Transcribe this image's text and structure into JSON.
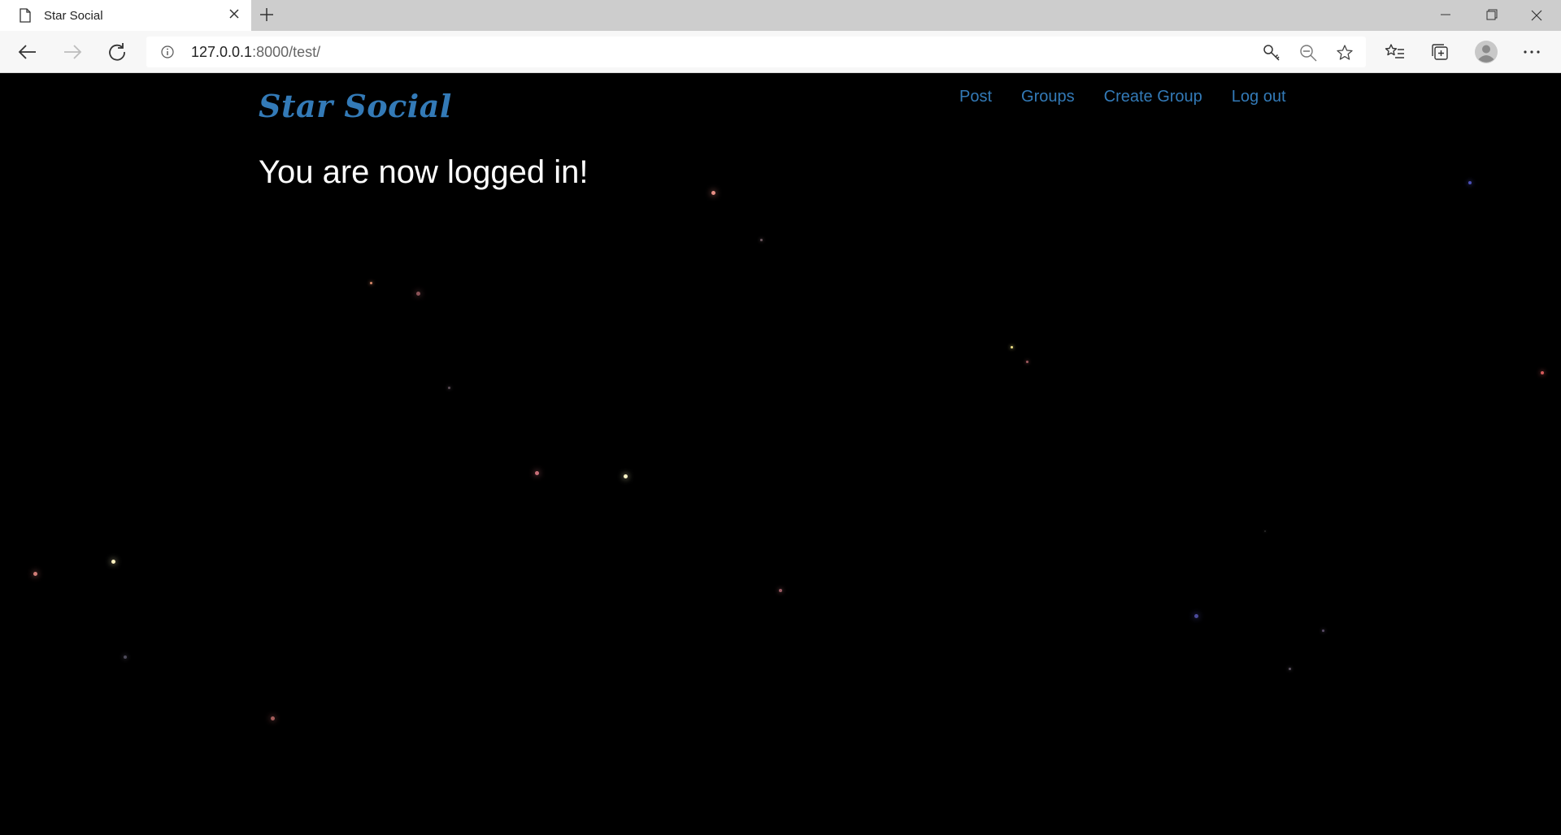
{
  "browser": {
    "tab_title": "Star Social",
    "url_host": "127.0.0.1",
    "url_rest": ":8000/test/"
  },
  "site": {
    "brand": "Star Social",
    "nav": {
      "post": "Post",
      "groups": "Groups",
      "create_group": "Create Group",
      "logout": "Log out"
    },
    "message": "You are now logged in!"
  },
  "colors": {
    "link": "#337ab7",
    "background": "#000000",
    "text": "#ffffff"
  }
}
